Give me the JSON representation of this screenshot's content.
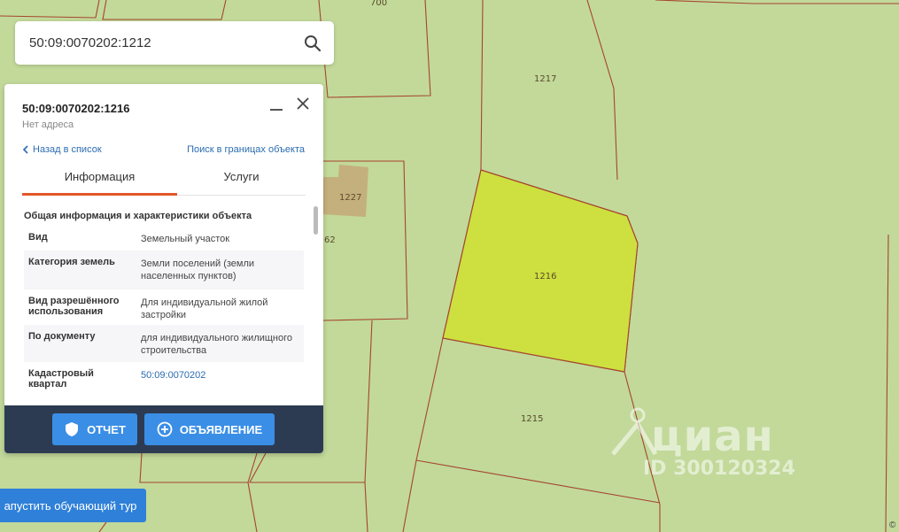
{
  "search": {
    "value": "50:09:0070202:1212",
    "icon": "search-icon"
  },
  "map_labels": {
    "p700": "700",
    "p1217": "1217",
    "p1216": "1216",
    "p1227": "1227",
    "p62": "62",
    "p1215": "1215"
  },
  "panel": {
    "title": "50:09:0070202:1216",
    "subtitle": "Нет адреса",
    "back": "Назад в список",
    "search_bounds": "Поиск в границах объекта",
    "tabs": [
      "Информация",
      "Услуги"
    ],
    "section_title": "Общая информация и характеристики объекта",
    "rows": [
      {
        "label": "Вид",
        "value": "Земельный участок"
      },
      {
        "label": "Категория земель",
        "value": "Земли поселений (земли населенных пунктов)"
      },
      {
        "label": "Вид разрешённого использования",
        "value": "Для индивидуальной жилой застройки"
      },
      {
        "label": "По документу",
        "value": "для индивидуального жилищного строительства"
      },
      {
        "label": "Кадастровый квартал",
        "value": "50:09:0070202"
      }
    ],
    "report_button": "ОТЧЕТ",
    "ad_button": "ОБЪЯВЛЕНИЕ"
  },
  "tour_button": "апустить обучающий тур",
  "watermark": {
    "logo": "циан",
    "id": "ID 300120324"
  },
  "copyright": "©",
  "colors": {
    "map_bg": "#c2d99a",
    "selected_parcel": "#cde040",
    "building": "#c4a878",
    "parcel_border": "#a5452f",
    "accent_tab": "#e2572a",
    "button_blue": "#3a8ee6",
    "footer": "#2d3b52"
  }
}
